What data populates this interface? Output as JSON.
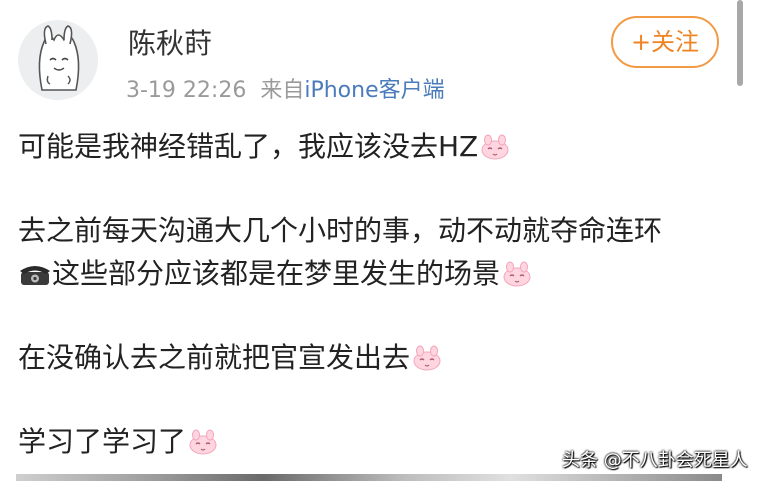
{
  "post": {
    "author": "陈秋莳",
    "date": "3-19 22:26",
    "via_prefix": "来自",
    "source": "iPhone客户端",
    "follow_label": "+关注",
    "paragraphs": [
      "可能是我神经错乱了，我应该没去HZ",
      "去之前每天沟通大几个小时的事，动不动就夺命连环",
      "这些部分应该都是在梦里发生的场景",
      "在没确认去之前就把官宣发出去",
      "学习了学习了"
    ],
    "emoji_icon": "pink-bunny-face-emoji",
    "phone_icon": "telephone-emoji"
  },
  "watermark": "头条 @不八卦会死星人",
  "colors": {
    "accent": "#f08322",
    "link": "#4a7bbb",
    "meta_gray": "#9a9a9a",
    "text": "#222222"
  }
}
